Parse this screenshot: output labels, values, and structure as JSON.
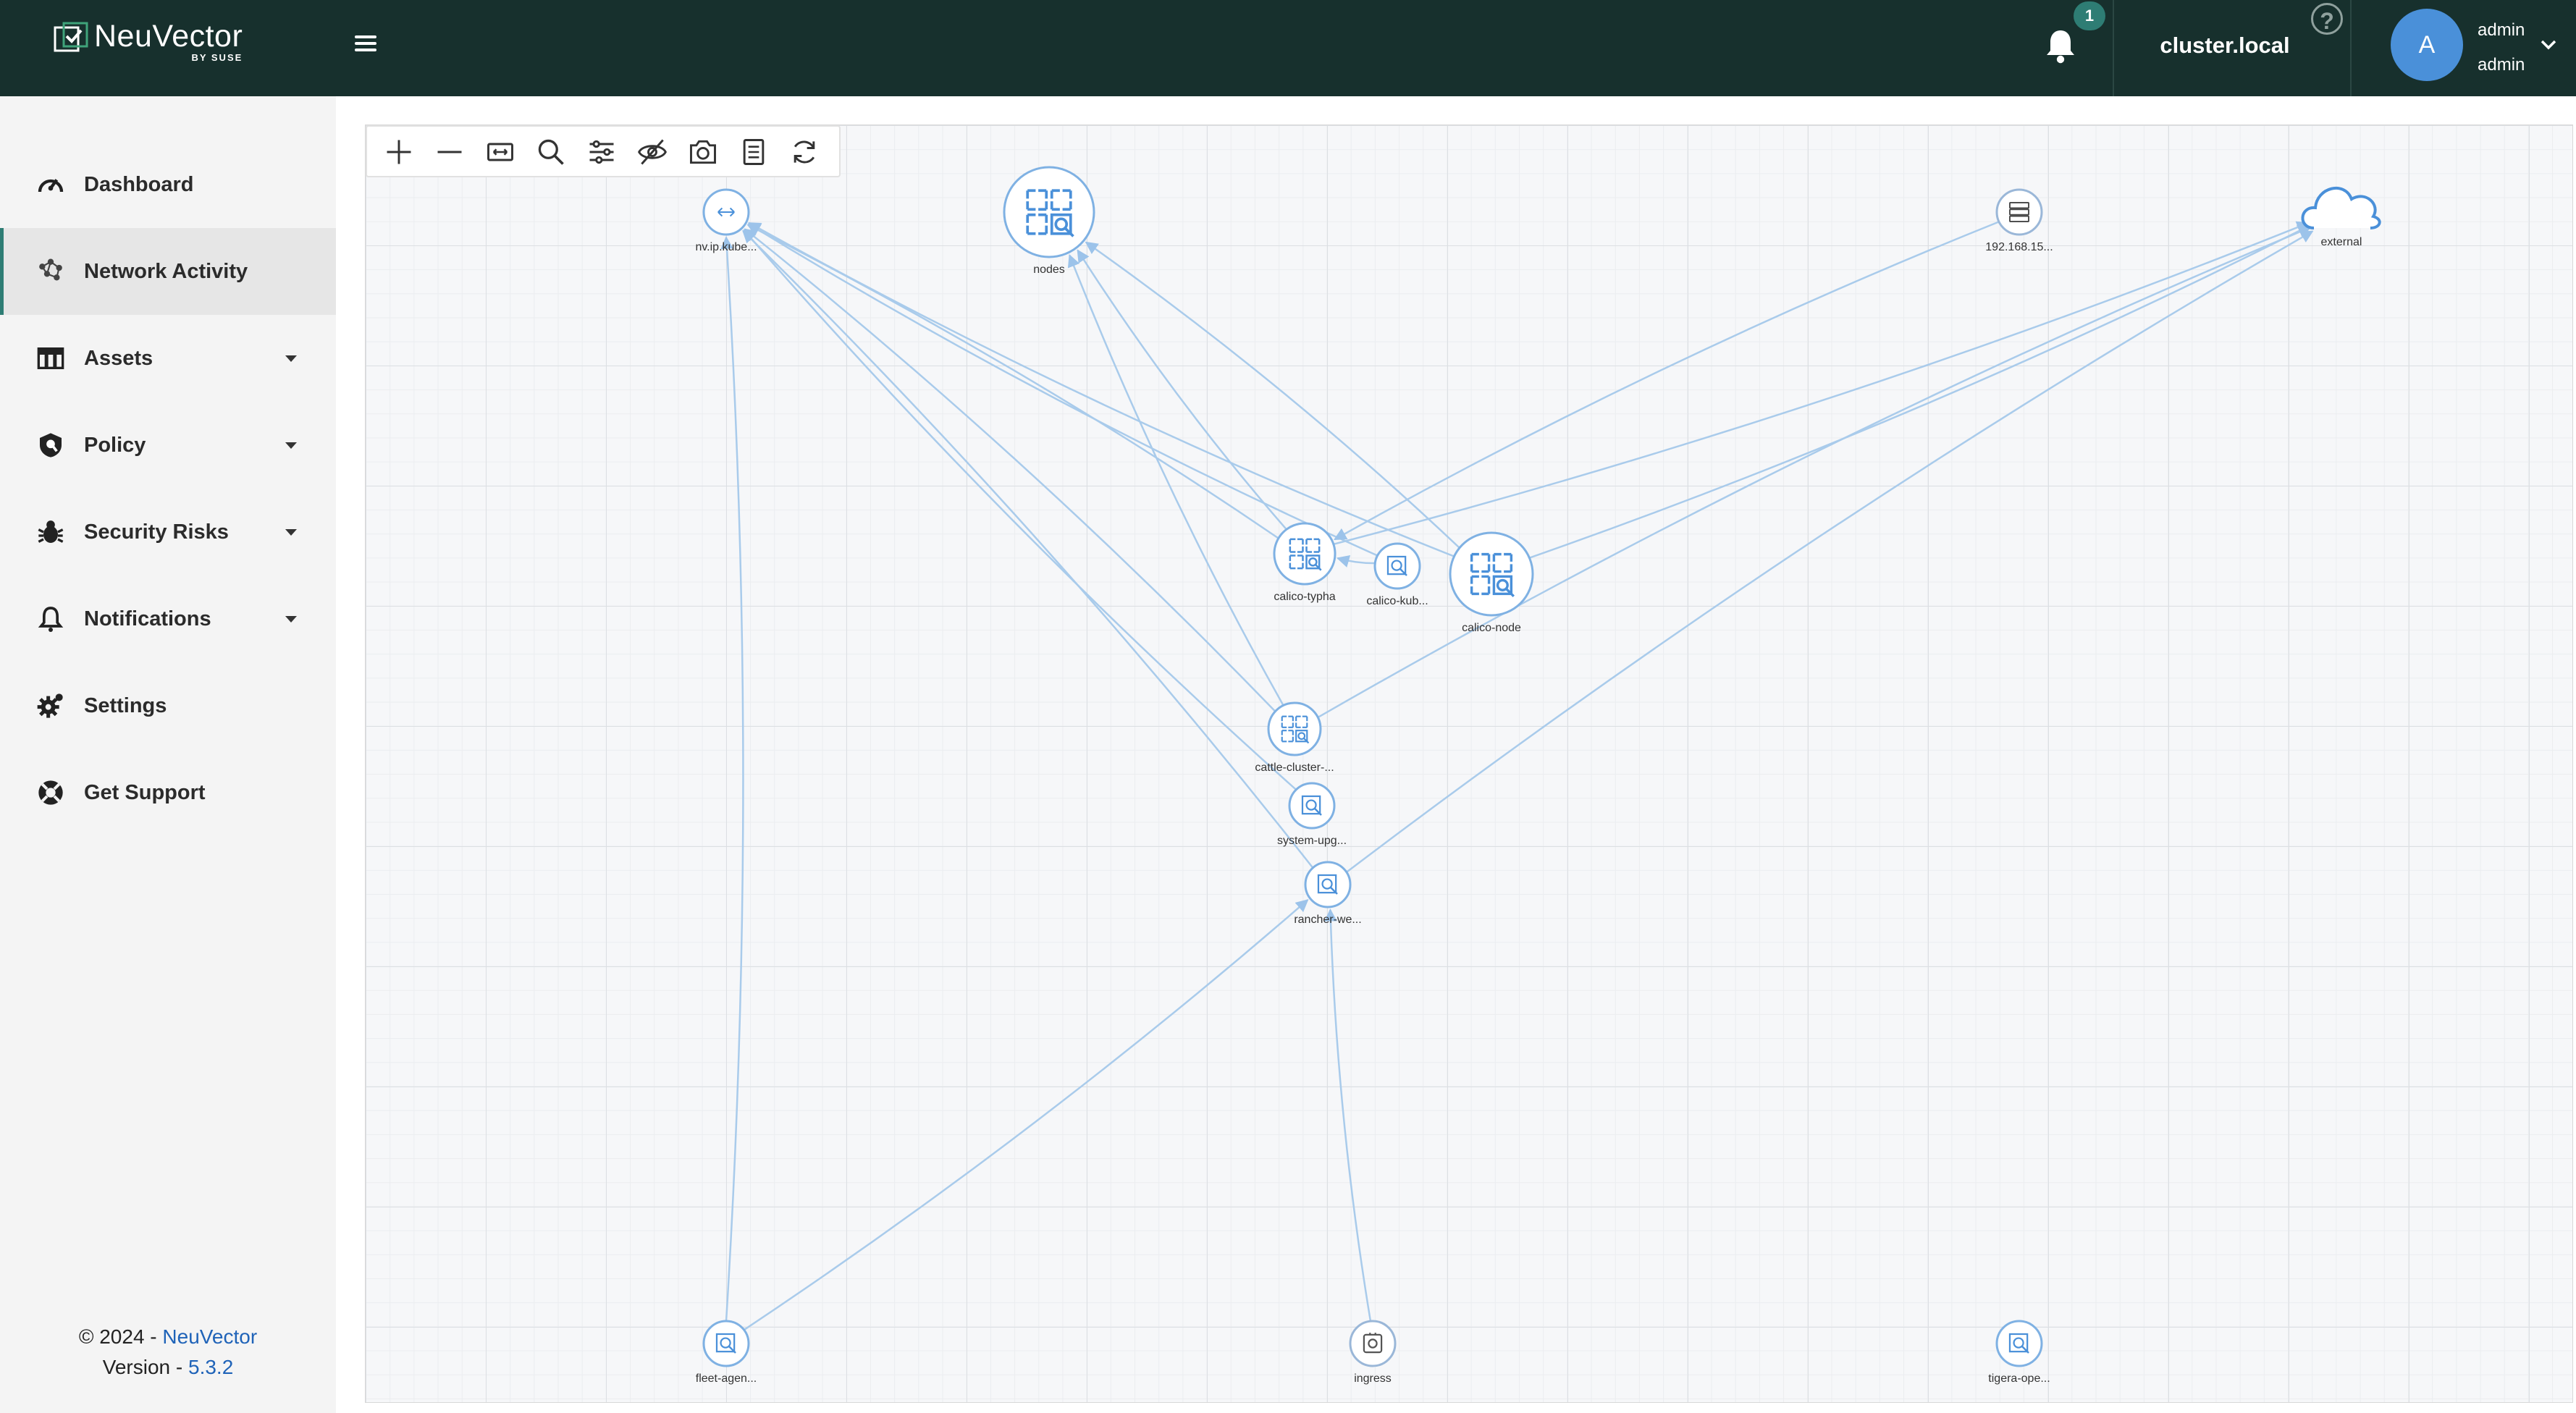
{
  "brand": {
    "name": "NeuVector",
    "sub": "BY SUSE"
  },
  "header": {
    "notification_count": "1",
    "cluster": "cluster.local",
    "help_label": "?",
    "avatar_initial": "A",
    "user_name": "admin",
    "user_role": "admin"
  },
  "sidebar": {
    "items": [
      {
        "label": "Dashboard",
        "icon": "dashboard-icon",
        "has_caret": false
      },
      {
        "label": "Network Activity",
        "icon": "network-activity-icon",
        "has_caret": false,
        "active": true
      },
      {
        "label": "Assets",
        "icon": "assets-icon",
        "has_caret": true
      },
      {
        "label": "Policy",
        "icon": "policy-shield-icon",
        "has_caret": true
      },
      {
        "label": "Security Risks",
        "icon": "bug-icon",
        "has_caret": true
      },
      {
        "label": "Notifications",
        "icon": "bell-icon",
        "has_caret": true
      },
      {
        "label": "Settings",
        "icon": "gear-icon",
        "has_caret": false
      },
      {
        "label": "Get Support",
        "icon": "lifebuoy-icon",
        "has_caret": false
      }
    ]
  },
  "footer": {
    "copyright": "© 2024 - ",
    "brand_link": "NeuVector",
    "version_prefix": "Version - ",
    "version": "5.3.2"
  },
  "toolbar": {
    "tools": [
      "zoom-in-icon",
      "zoom-out-icon",
      "fit-view-icon",
      "search-icon",
      "filter-icon",
      "hide-icon",
      "snapshot-icon",
      "report-icon",
      "refresh-icon"
    ]
  },
  "graph": {
    "nodes": [
      {
        "id": "nv",
        "label": "nv.ip.kube...",
        "kind": "ip-service"
      },
      {
        "id": "nodes",
        "label": "nodes",
        "kind": "group-large"
      },
      {
        "id": "ip192",
        "label": "192.168.15...",
        "kind": "server"
      },
      {
        "id": "external",
        "label": "external",
        "kind": "cloud"
      },
      {
        "id": "typha",
        "label": "calico-typha",
        "kind": "group"
      },
      {
        "id": "kub",
        "label": "calico-kub...",
        "kind": "workload"
      },
      {
        "id": "calnode",
        "label": "calico-node",
        "kind": "group-large"
      },
      {
        "id": "cattle",
        "label": "cattle-cluster-...",
        "kind": "group"
      },
      {
        "id": "sysupg",
        "label": "system-upg...",
        "kind": "workload"
      },
      {
        "id": "rancher",
        "label": "rancher-we...",
        "kind": "workload"
      },
      {
        "id": "fleet",
        "label": "fleet-agen...",
        "kind": "workload"
      },
      {
        "id": "ingress",
        "label": "ingress",
        "kind": "service"
      },
      {
        "id": "tigera",
        "label": "tigera-ope...",
        "kind": "workload"
      }
    ],
    "edges": [
      [
        "typha",
        "nv"
      ],
      [
        "calnode",
        "nv"
      ],
      [
        "cattle",
        "nv"
      ],
      [
        "sysupg",
        "nv"
      ],
      [
        "rancher",
        "nv"
      ],
      [
        "kub",
        "nv"
      ],
      [
        "fleet",
        "nv"
      ],
      [
        "typha",
        "nodes"
      ],
      [
        "calnode",
        "nodes"
      ],
      [
        "cattle",
        "nodes"
      ],
      [
        "ip192",
        "typha"
      ],
      [
        "kub",
        "typha"
      ],
      [
        "calnode",
        "external"
      ],
      [
        "cattle",
        "external"
      ],
      [
        "typha",
        "external"
      ],
      [
        "rancher",
        "external"
      ],
      [
        "fleet",
        "rancher"
      ],
      [
        "ingress",
        "rancher"
      ]
    ]
  }
}
